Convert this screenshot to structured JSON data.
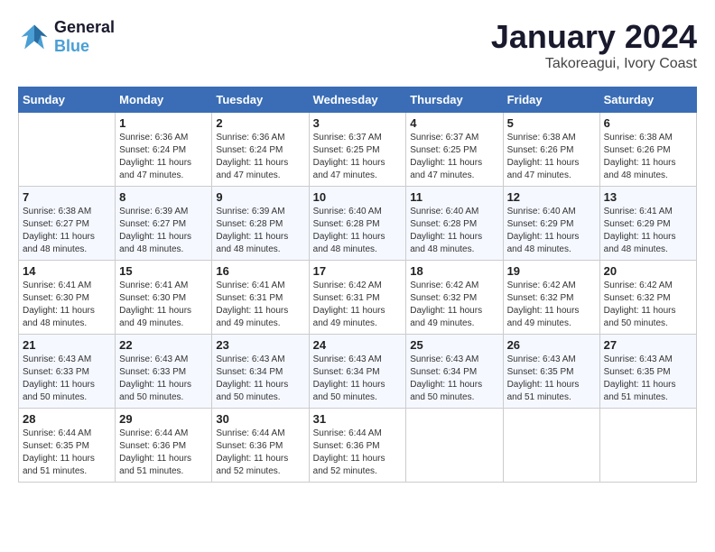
{
  "header": {
    "logo_line1": "General",
    "logo_line2": "Blue",
    "month": "January 2024",
    "location": "Takoreagui, Ivory Coast"
  },
  "weekdays": [
    "Sunday",
    "Monday",
    "Tuesday",
    "Wednesday",
    "Thursday",
    "Friday",
    "Saturday"
  ],
  "weeks": [
    [
      {
        "day": "",
        "sunrise": "",
        "sunset": "",
        "daylight": ""
      },
      {
        "day": "1",
        "sunrise": "Sunrise: 6:36 AM",
        "sunset": "Sunset: 6:24 PM",
        "daylight": "Daylight: 11 hours and 47 minutes."
      },
      {
        "day": "2",
        "sunrise": "Sunrise: 6:36 AM",
        "sunset": "Sunset: 6:24 PM",
        "daylight": "Daylight: 11 hours and 47 minutes."
      },
      {
        "day": "3",
        "sunrise": "Sunrise: 6:37 AM",
        "sunset": "Sunset: 6:25 PM",
        "daylight": "Daylight: 11 hours and 47 minutes."
      },
      {
        "day": "4",
        "sunrise": "Sunrise: 6:37 AM",
        "sunset": "Sunset: 6:25 PM",
        "daylight": "Daylight: 11 hours and 47 minutes."
      },
      {
        "day": "5",
        "sunrise": "Sunrise: 6:38 AM",
        "sunset": "Sunset: 6:26 PM",
        "daylight": "Daylight: 11 hours and 47 minutes."
      },
      {
        "day": "6",
        "sunrise": "Sunrise: 6:38 AM",
        "sunset": "Sunset: 6:26 PM",
        "daylight": "Daylight: 11 hours and 48 minutes."
      }
    ],
    [
      {
        "day": "7",
        "sunrise": "Sunrise: 6:38 AM",
        "sunset": "Sunset: 6:27 PM",
        "daylight": "Daylight: 11 hours and 48 minutes."
      },
      {
        "day": "8",
        "sunrise": "Sunrise: 6:39 AM",
        "sunset": "Sunset: 6:27 PM",
        "daylight": "Daylight: 11 hours and 48 minutes."
      },
      {
        "day": "9",
        "sunrise": "Sunrise: 6:39 AM",
        "sunset": "Sunset: 6:28 PM",
        "daylight": "Daylight: 11 hours and 48 minutes."
      },
      {
        "day": "10",
        "sunrise": "Sunrise: 6:40 AM",
        "sunset": "Sunset: 6:28 PM",
        "daylight": "Daylight: 11 hours and 48 minutes."
      },
      {
        "day": "11",
        "sunrise": "Sunrise: 6:40 AM",
        "sunset": "Sunset: 6:28 PM",
        "daylight": "Daylight: 11 hours and 48 minutes."
      },
      {
        "day": "12",
        "sunrise": "Sunrise: 6:40 AM",
        "sunset": "Sunset: 6:29 PM",
        "daylight": "Daylight: 11 hours and 48 minutes."
      },
      {
        "day": "13",
        "sunrise": "Sunrise: 6:41 AM",
        "sunset": "Sunset: 6:29 PM",
        "daylight": "Daylight: 11 hours and 48 minutes."
      }
    ],
    [
      {
        "day": "14",
        "sunrise": "Sunrise: 6:41 AM",
        "sunset": "Sunset: 6:30 PM",
        "daylight": "Daylight: 11 hours and 48 minutes."
      },
      {
        "day": "15",
        "sunrise": "Sunrise: 6:41 AM",
        "sunset": "Sunset: 6:30 PM",
        "daylight": "Daylight: 11 hours and 49 minutes."
      },
      {
        "day": "16",
        "sunrise": "Sunrise: 6:41 AM",
        "sunset": "Sunset: 6:31 PM",
        "daylight": "Daylight: 11 hours and 49 minutes."
      },
      {
        "day": "17",
        "sunrise": "Sunrise: 6:42 AM",
        "sunset": "Sunset: 6:31 PM",
        "daylight": "Daylight: 11 hours and 49 minutes."
      },
      {
        "day": "18",
        "sunrise": "Sunrise: 6:42 AM",
        "sunset": "Sunset: 6:32 PM",
        "daylight": "Daylight: 11 hours and 49 minutes."
      },
      {
        "day": "19",
        "sunrise": "Sunrise: 6:42 AM",
        "sunset": "Sunset: 6:32 PM",
        "daylight": "Daylight: 11 hours and 49 minutes."
      },
      {
        "day": "20",
        "sunrise": "Sunrise: 6:42 AM",
        "sunset": "Sunset: 6:32 PM",
        "daylight": "Daylight: 11 hours and 50 minutes."
      }
    ],
    [
      {
        "day": "21",
        "sunrise": "Sunrise: 6:43 AM",
        "sunset": "Sunset: 6:33 PM",
        "daylight": "Daylight: 11 hours and 50 minutes."
      },
      {
        "day": "22",
        "sunrise": "Sunrise: 6:43 AM",
        "sunset": "Sunset: 6:33 PM",
        "daylight": "Daylight: 11 hours and 50 minutes."
      },
      {
        "day": "23",
        "sunrise": "Sunrise: 6:43 AM",
        "sunset": "Sunset: 6:34 PM",
        "daylight": "Daylight: 11 hours and 50 minutes."
      },
      {
        "day": "24",
        "sunrise": "Sunrise: 6:43 AM",
        "sunset": "Sunset: 6:34 PM",
        "daylight": "Daylight: 11 hours and 50 minutes."
      },
      {
        "day": "25",
        "sunrise": "Sunrise: 6:43 AM",
        "sunset": "Sunset: 6:34 PM",
        "daylight": "Daylight: 11 hours and 50 minutes."
      },
      {
        "day": "26",
        "sunrise": "Sunrise: 6:43 AM",
        "sunset": "Sunset: 6:35 PM",
        "daylight": "Daylight: 11 hours and 51 minutes."
      },
      {
        "day": "27",
        "sunrise": "Sunrise: 6:43 AM",
        "sunset": "Sunset: 6:35 PM",
        "daylight": "Daylight: 11 hours and 51 minutes."
      }
    ],
    [
      {
        "day": "28",
        "sunrise": "Sunrise: 6:44 AM",
        "sunset": "Sunset: 6:35 PM",
        "daylight": "Daylight: 11 hours and 51 minutes."
      },
      {
        "day": "29",
        "sunrise": "Sunrise: 6:44 AM",
        "sunset": "Sunset: 6:36 PM",
        "daylight": "Daylight: 11 hours and 51 minutes."
      },
      {
        "day": "30",
        "sunrise": "Sunrise: 6:44 AM",
        "sunset": "Sunset: 6:36 PM",
        "daylight": "Daylight: 11 hours and 52 minutes."
      },
      {
        "day": "31",
        "sunrise": "Sunrise: 6:44 AM",
        "sunset": "Sunset: 6:36 PM",
        "daylight": "Daylight: 11 hours and 52 minutes."
      },
      {
        "day": "",
        "sunrise": "",
        "sunset": "",
        "daylight": ""
      },
      {
        "day": "",
        "sunrise": "",
        "sunset": "",
        "daylight": ""
      },
      {
        "day": "",
        "sunrise": "",
        "sunset": "",
        "daylight": ""
      }
    ]
  ]
}
